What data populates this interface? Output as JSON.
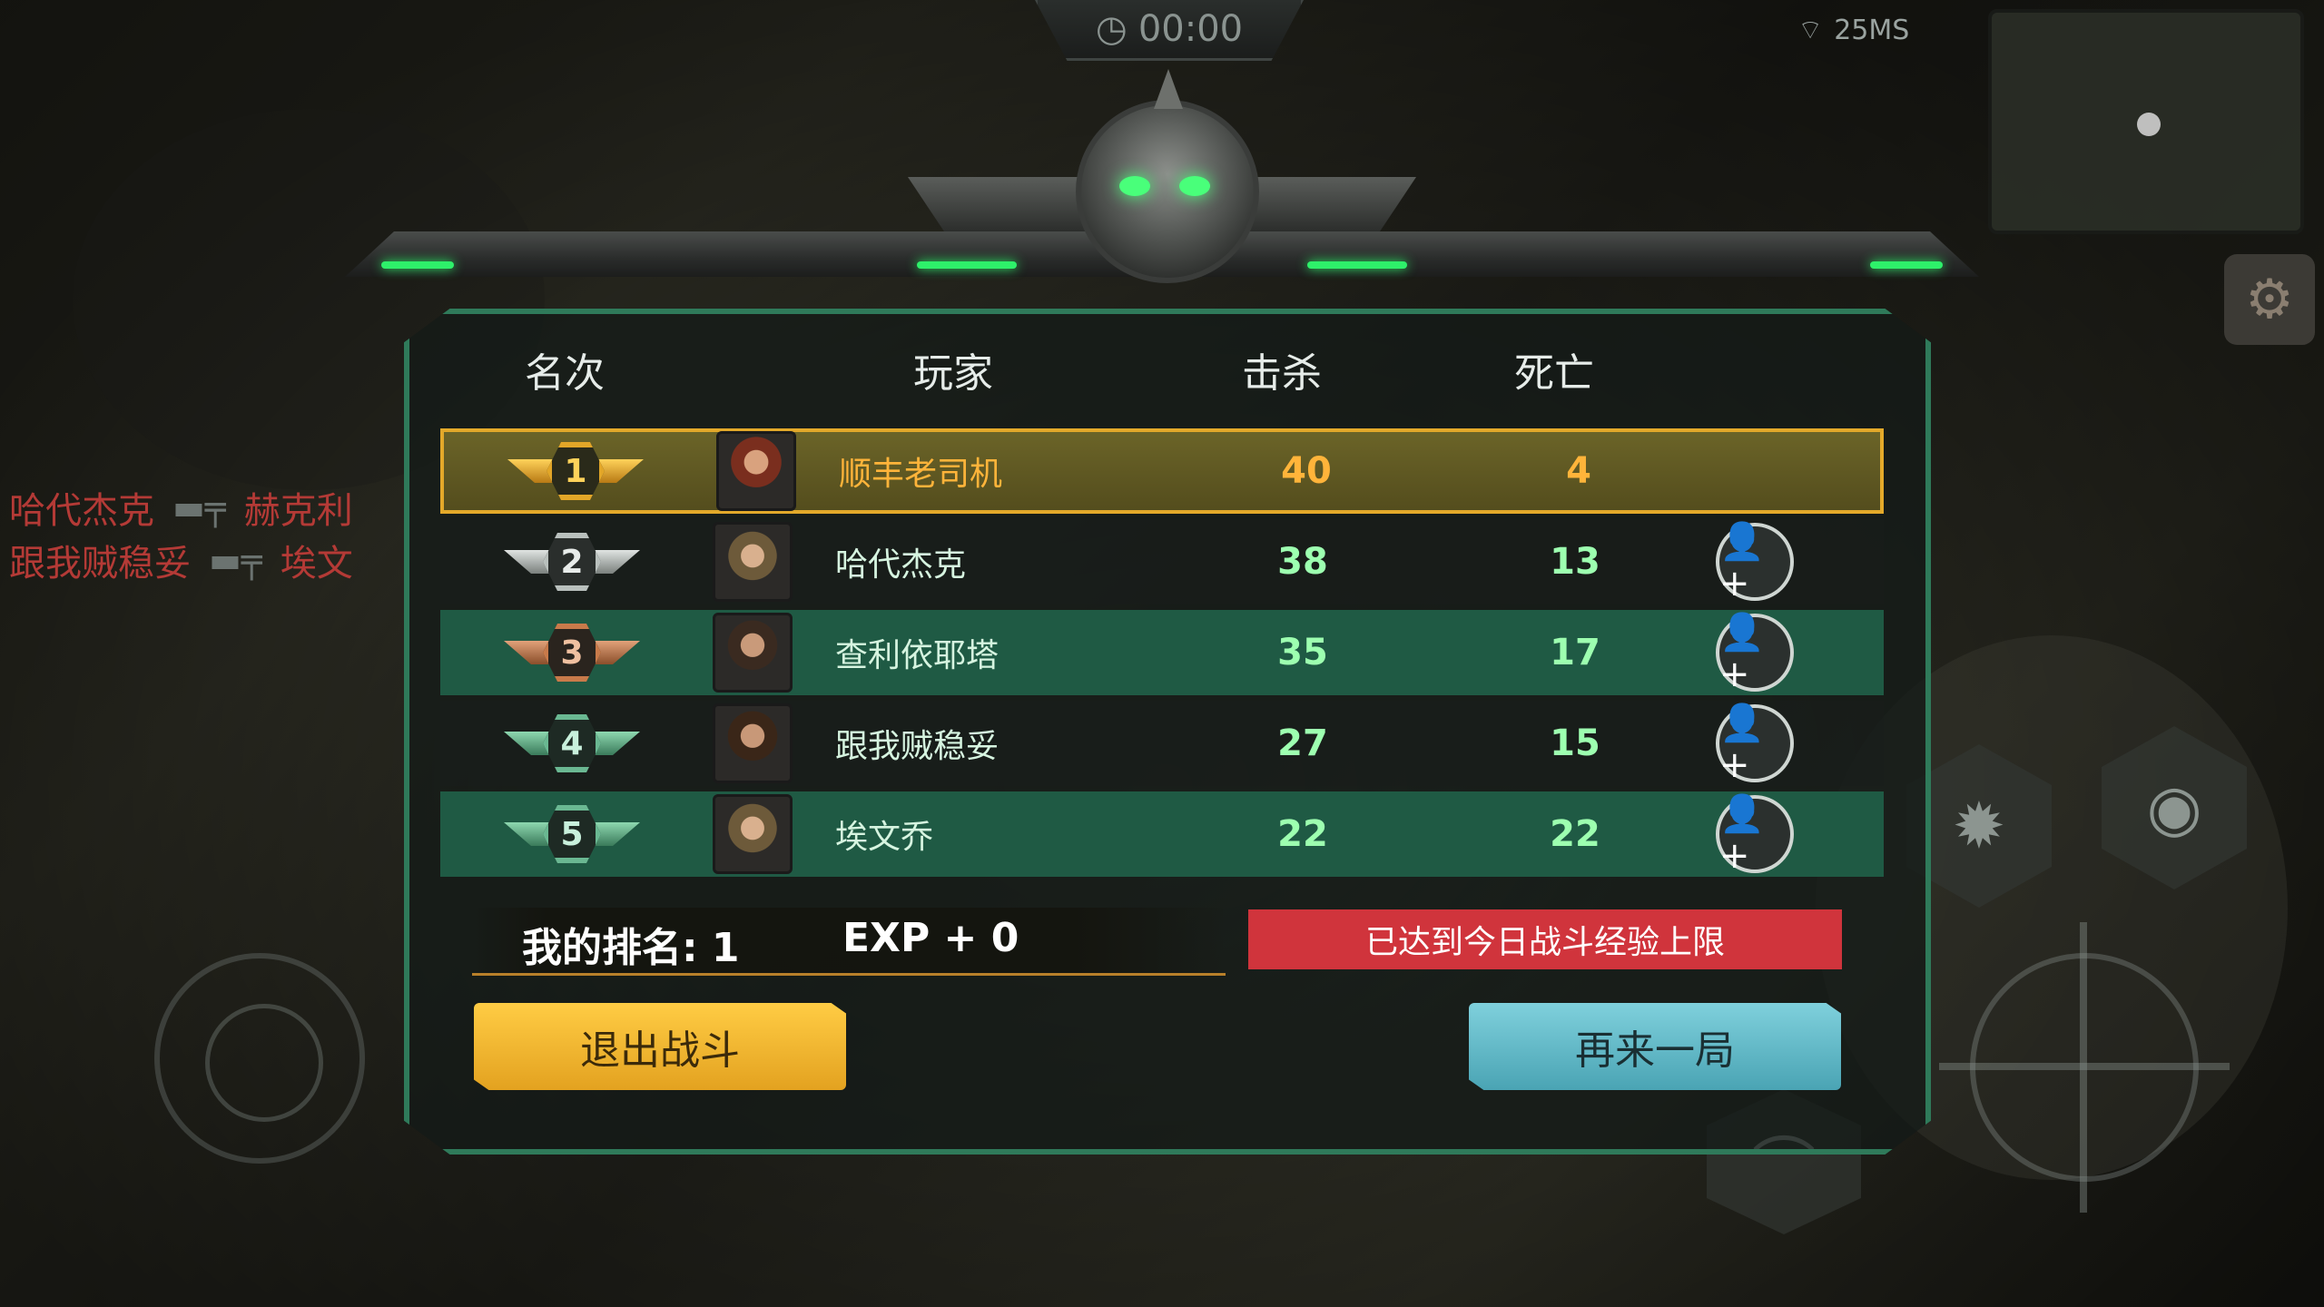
{
  "hud": {
    "timer": "00:00",
    "ping": "25MS"
  },
  "kill_feed": [
    {
      "killer": "哈代杰克",
      "victim": "赫克利"
    },
    {
      "killer": "跟我贼稳妥",
      "victim": "埃文"
    }
  ],
  "scoreboard": {
    "headers": {
      "rank": "名次",
      "player": "玩家",
      "kills": "击杀",
      "deaths": "死亡"
    },
    "rows": [
      {
        "rank": "1",
        "name": "顺丰老司机",
        "kills": "40",
        "deaths": "4"
      },
      {
        "rank": "2",
        "name": "哈代杰克",
        "kills": "38",
        "deaths": "13"
      },
      {
        "rank": "3",
        "name": "查利依耶塔",
        "kills": "35",
        "deaths": "17"
      },
      {
        "rank": "4",
        "name": "跟我贼稳妥",
        "kills": "27",
        "deaths": "15"
      },
      {
        "rank": "5",
        "name": "埃文乔",
        "kills": "22",
        "deaths": "22"
      }
    ],
    "my_rank": "我的排名: 1",
    "exp": "EXP + 0",
    "limit_notice": "已达到今日战斗经验上限"
  },
  "buttons": {
    "exit": "退出战斗",
    "again": "再来一局"
  },
  "colors": {
    "panel_border": "#2f7a5a",
    "row_green": "#1f5a44",
    "highlight_gold": "#e3a92a",
    "notice_red": "#d0343c",
    "exit_button": "#f0b432",
    "again_button": "#62bac8",
    "stat_text": "#9dffb0"
  }
}
